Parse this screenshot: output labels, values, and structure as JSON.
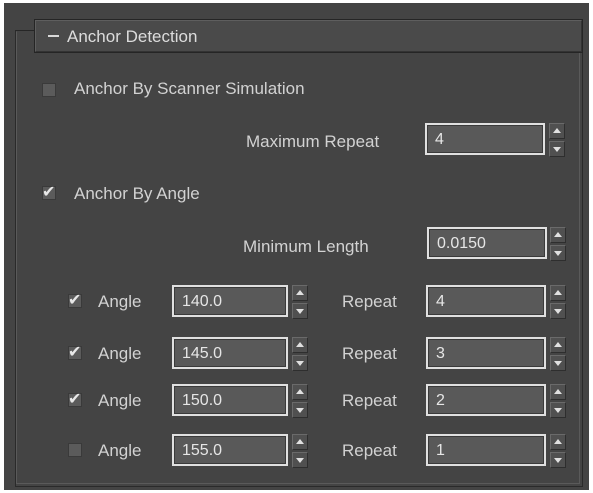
{
  "rollout": {
    "title": "Anchor Detection",
    "collapse_symbol": "minus-icon"
  },
  "scanner": {
    "label": "Anchor By Scanner Simulation",
    "checked": false,
    "max_repeat_label": "Maximum Repeat",
    "max_repeat_value": "4"
  },
  "angle_section": {
    "label": "Anchor By Angle",
    "checked": true,
    "min_length_label": "Minimum Length",
    "min_length_value": "0.0150"
  },
  "angle_rows": [
    {
      "checked": true,
      "label": "Angle",
      "angle": "140.0",
      "repeat_label": "Repeat",
      "repeat": "4"
    },
    {
      "checked": true,
      "label": "Angle",
      "angle": "145.0",
      "repeat_label": "Repeat",
      "repeat": "3"
    },
    {
      "checked": true,
      "label": "Angle",
      "angle": "150.0",
      "repeat_label": "Repeat",
      "repeat": "2"
    },
    {
      "checked": false,
      "label": "Angle",
      "angle": "155.0",
      "repeat_label": "Repeat",
      "repeat": "1"
    }
  ],
  "colors": {
    "panel_bg": "#444444",
    "field_bg": "#595959",
    "field_border": "#e0e0e0",
    "text": "#d2d2d2"
  }
}
